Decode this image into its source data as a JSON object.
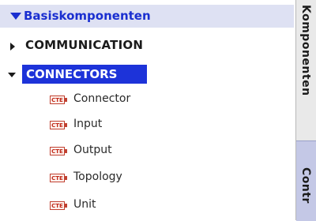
{
  "header": {
    "title": "Basiskomponenten"
  },
  "categories": [
    {
      "label": "COMMUNICATION",
      "expanded": false
    },
    {
      "label": "CONNECTORS",
      "expanded": true,
      "selected": true
    }
  ],
  "items": [
    {
      "label": "Connector",
      "icon": "cte-block-icon"
    },
    {
      "label": "Input",
      "icon": "cte-block-icon"
    },
    {
      "label": "Output",
      "icon": "cte-block-icon"
    },
    {
      "label": "Topology",
      "icon": "cte-block-icon"
    },
    {
      "label": "Unit",
      "icon": "cte-block-icon"
    }
  ],
  "icon_text": "CTE",
  "tabs": [
    {
      "label": "Komponenten",
      "active": true
    },
    {
      "label": "Contr",
      "active": false
    }
  ],
  "colors": {
    "accent": "#1d33d9",
    "header_bg": "#dee1f3",
    "inactive_tab": "#c4c8e6"
  }
}
